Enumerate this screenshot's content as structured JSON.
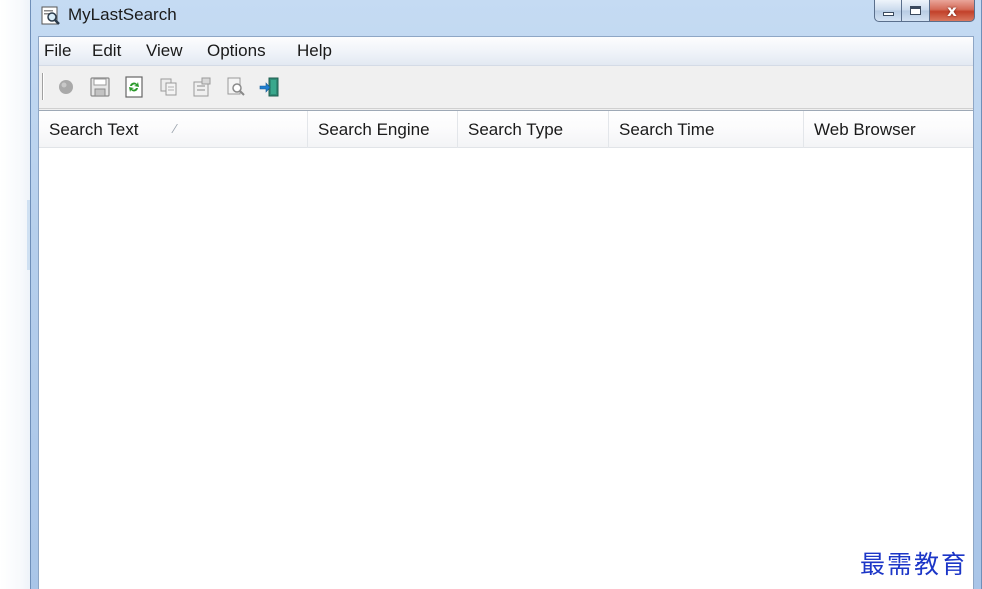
{
  "window": {
    "title": "MyLastSearch",
    "close_symbol": "x"
  },
  "menu": [
    "File",
    "Edit",
    "View",
    "Options",
    "Help"
  ],
  "toolbar": {
    "buttons": [
      {
        "icon": "record-icon"
      },
      {
        "icon": "save-icon"
      },
      {
        "icon": "refresh-icon"
      },
      {
        "icon": "copy-icon"
      },
      {
        "icon": "properties-icon"
      },
      {
        "icon": "find-icon"
      },
      {
        "icon": "exit-icon"
      }
    ]
  },
  "columns": [
    {
      "label": "Search Text",
      "sort": "ascending"
    },
    {
      "label": "Search Engine"
    },
    {
      "label": "Search Type"
    },
    {
      "label": "Search Time"
    },
    {
      "label": "Web Browser"
    }
  ],
  "rows": [],
  "watermark": "最需教育",
  "colors": {
    "title_bar": "#b6cfec",
    "close_button": "#c2402a",
    "watermark": "#1c36c7",
    "list_background": "#ffffff"
  }
}
